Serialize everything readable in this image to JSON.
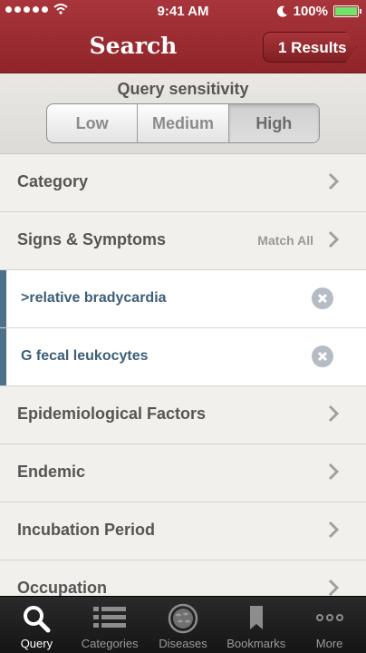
{
  "status_bar": {
    "time": "9:41 AM",
    "battery": "100%"
  },
  "nav": {
    "title": "Search",
    "results_button": "1 Results"
  },
  "sensitivity": {
    "label": "Query sensitivity",
    "options": [
      "Low",
      "Medium",
      "High"
    ],
    "selected": "High"
  },
  "rows": {
    "category": {
      "label": "Category"
    },
    "signs": {
      "label": "Signs & Symptoms",
      "detail": "Match All"
    },
    "chip1": {
      "label": ">relative bradycardia"
    },
    "chip2": {
      "label": "G  fecal leukocytes"
    },
    "epi": {
      "label": "Epidemiological Factors"
    },
    "endemic": {
      "label": "Endemic"
    },
    "incubation": {
      "label": "Incubation Period"
    },
    "occupation": {
      "label": "Occupation"
    }
  },
  "tabs": [
    {
      "label": "Query",
      "icon": "search-icon",
      "active": true
    },
    {
      "label": "Categories",
      "icon": "list-icon"
    },
    {
      "label": "Diseases",
      "icon": "petri-dish-icon"
    },
    {
      "label": "Bookmarks",
      "icon": "bookmark-icon"
    },
    {
      "label": "More",
      "icon": "more-icon"
    }
  ],
  "colors": {
    "nav": "#9b2d32",
    "accent_bar": "#4d7188",
    "tabbar": "#1e1e1e"
  }
}
